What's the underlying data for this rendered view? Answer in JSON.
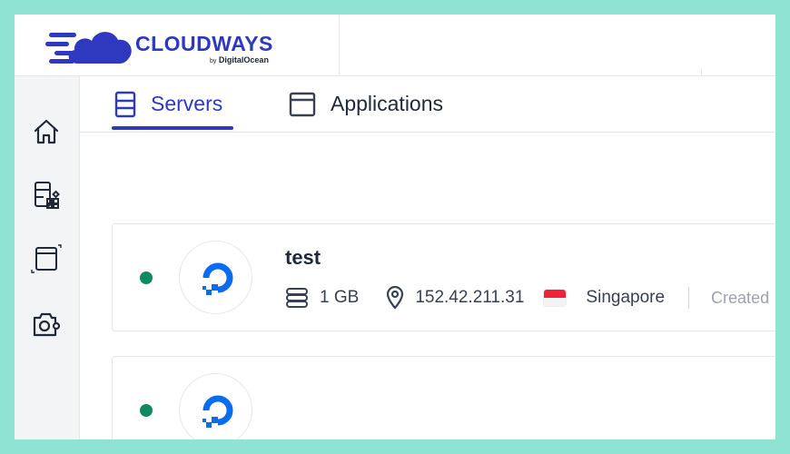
{
  "header": {
    "brand_name": "CLOUDWAYS",
    "brand_by": "by",
    "brand_company": "DigitalOcean",
    "brand_color": "#2f39bf"
  },
  "sidebar": {
    "items": [
      {
        "name": "home",
        "icon": "home-icon"
      },
      {
        "name": "servers-grid",
        "icon": "server-apps-icon"
      },
      {
        "name": "window",
        "icon": "window-icon"
      },
      {
        "name": "addons",
        "icon": "camera-gear-icon"
      }
    ]
  },
  "tabs": [
    {
      "label": "Servers",
      "icon": "server-icon",
      "active": true
    },
    {
      "label": "Applications",
      "icon": "application-window-icon",
      "active": false
    }
  ],
  "servers": [
    {
      "name": "test",
      "status": "running",
      "status_color": "#0f8a5f",
      "provider_icon": "digitalocean-icon",
      "size": "1 GB",
      "ip": "152.42.211.31",
      "location": "Singapore",
      "created": "Created"
    },
    {
      "name": "",
      "status": "running",
      "status_color": "#0f8a5f",
      "provider_icon": "digitalocean-icon"
    }
  ]
}
